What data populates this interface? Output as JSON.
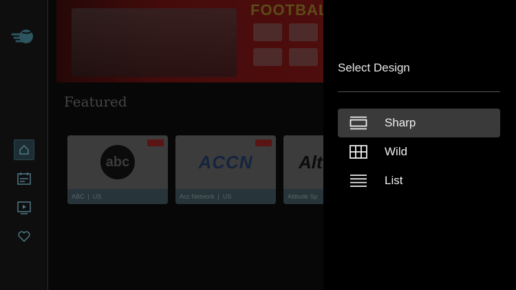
{
  "sidebar": {
    "logo": "app-logo",
    "items": [
      {
        "name": "home",
        "icon": "home-icon",
        "active": true
      },
      {
        "name": "guide",
        "icon": "tv-guide-icon",
        "active": false
      },
      {
        "name": "vod",
        "icon": "play-screen-icon",
        "active": false
      },
      {
        "name": "favorites",
        "icon": "heart-icon",
        "active": false
      }
    ]
  },
  "banner": {
    "title": "FOOTBALL L"
  },
  "featured": {
    "title": "Featured",
    "cards": [
      {
        "logo": "abc",
        "channel": "ABC",
        "country": "US"
      },
      {
        "logo": "ACCN",
        "channel": "Acc Network",
        "country": "US"
      },
      {
        "logo": "Alt",
        "channel": "Altitude Sp",
        "country": ""
      }
    ]
  },
  "design_panel": {
    "title": "Select Design",
    "options": [
      {
        "label": "Sharp",
        "icon": "sharp-layout-icon",
        "selected": true
      },
      {
        "label": "Wild",
        "icon": "grid-layout-icon",
        "selected": false
      },
      {
        "label": "List",
        "icon": "list-layout-icon",
        "selected": false
      }
    ]
  },
  "colors": {
    "panel_bg": "#000000",
    "selected_bg": "#3a3a3a",
    "sidebar_active": "#1c2e34"
  }
}
